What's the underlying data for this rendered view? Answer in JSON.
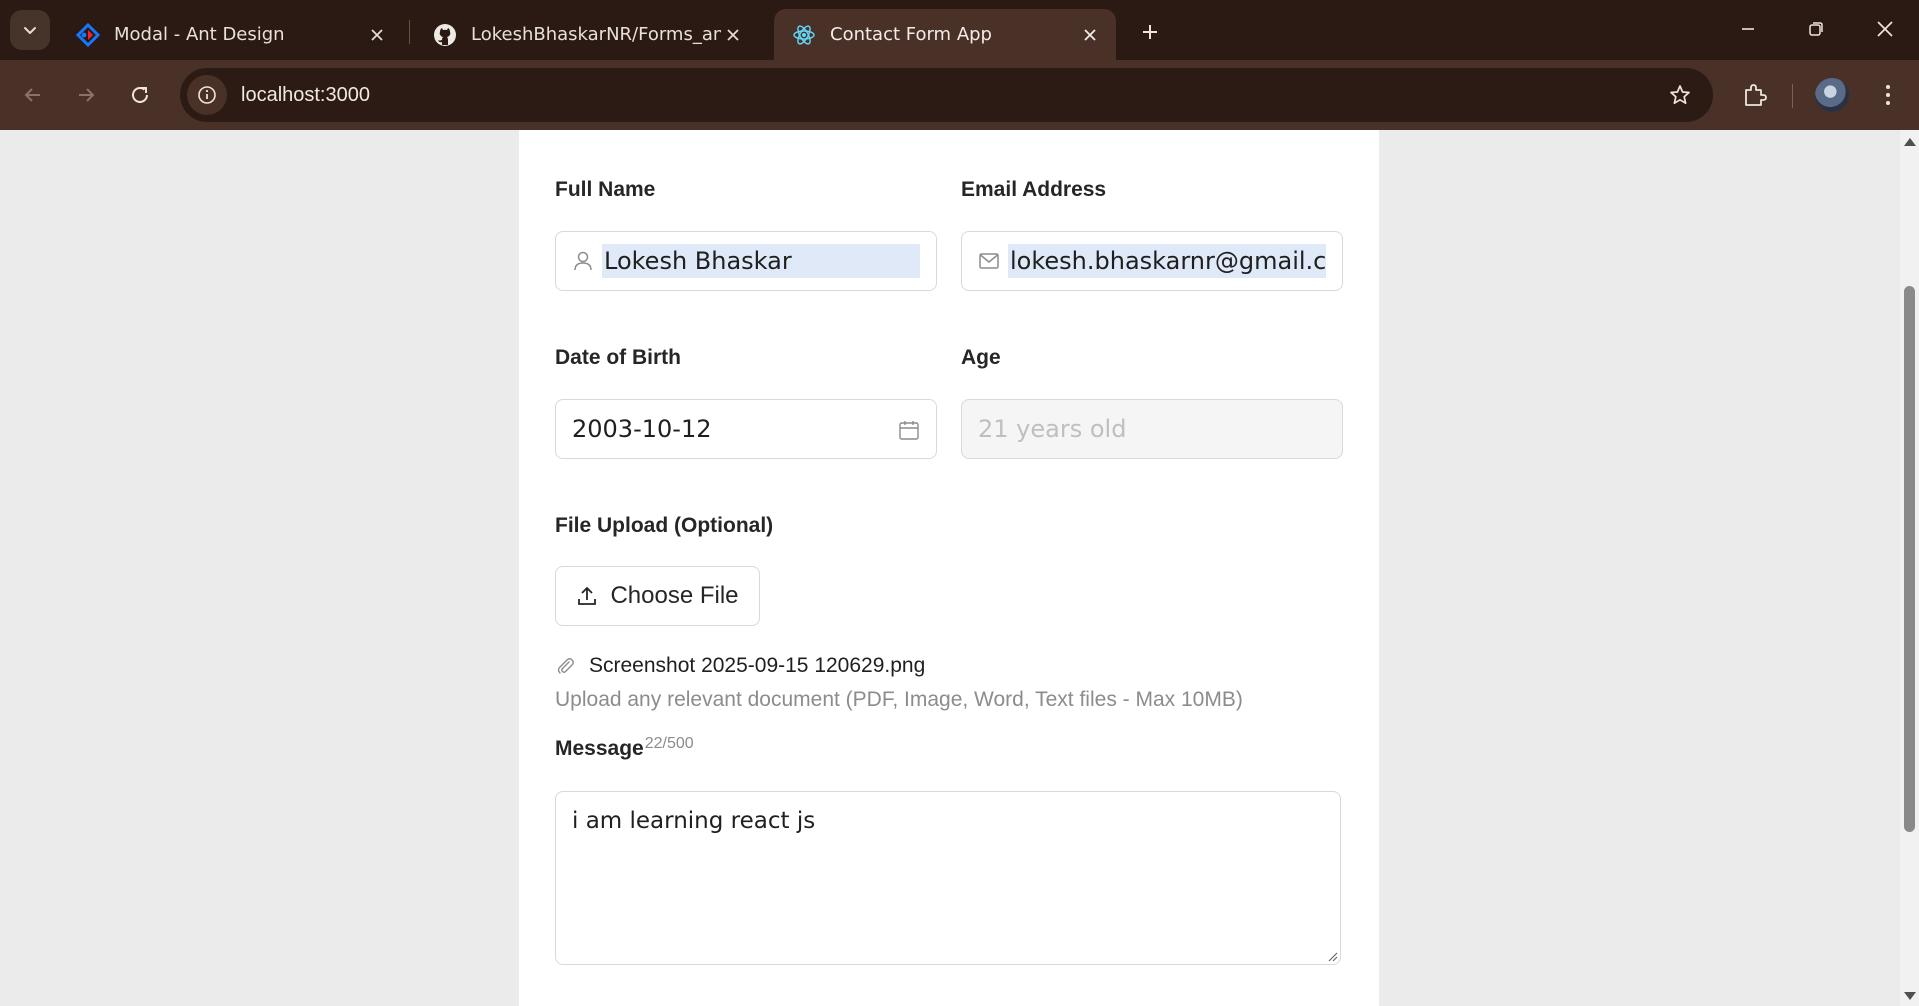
{
  "browser": {
    "tabs": [
      {
        "title": "Modal - Ant Design",
        "icon": "ant-design-logo-icon"
      },
      {
        "title": "LokeshBhaskarNR/Forms_and_Uploads",
        "icon": "github-icon"
      },
      {
        "title": "Contact Form App",
        "icon": "react-logo-icon",
        "active": true
      }
    ],
    "url": "localhost:3000"
  },
  "form": {
    "full_name": {
      "label": "Full Name",
      "value": "Lokesh Bhaskar",
      "icon": "user-icon"
    },
    "email": {
      "label": "Email Address",
      "value": "lokesh.bhaskarnr@gmail.com",
      "icon": "mail-icon"
    },
    "dob": {
      "label": "Date of Birth",
      "value": "2003-10-12",
      "icon": "calendar-icon"
    },
    "age": {
      "label": "Age",
      "placeholder": "21 years old"
    },
    "upload": {
      "label": "File Upload (Optional)",
      "button": "Choose File",
      "file_name": "Screenshot 2025-09-15 120629.png",
      "hint": "Upload any relevant document (PDF, Image, Word, Text files - Max 10MB)"
    },
    "message": {
      "label": "Message",
      "counter": "22/500",
      "value": "i am learning react js"
    }
  },
  "colors": {
    "frame_dark": "#2b1a13",
    "toolbar": "#4a3127",
    "card_bg": "#ffffff",
    "page_bg": "#ebebeb",
    "selection": "#dfe9f7"
  }
}
